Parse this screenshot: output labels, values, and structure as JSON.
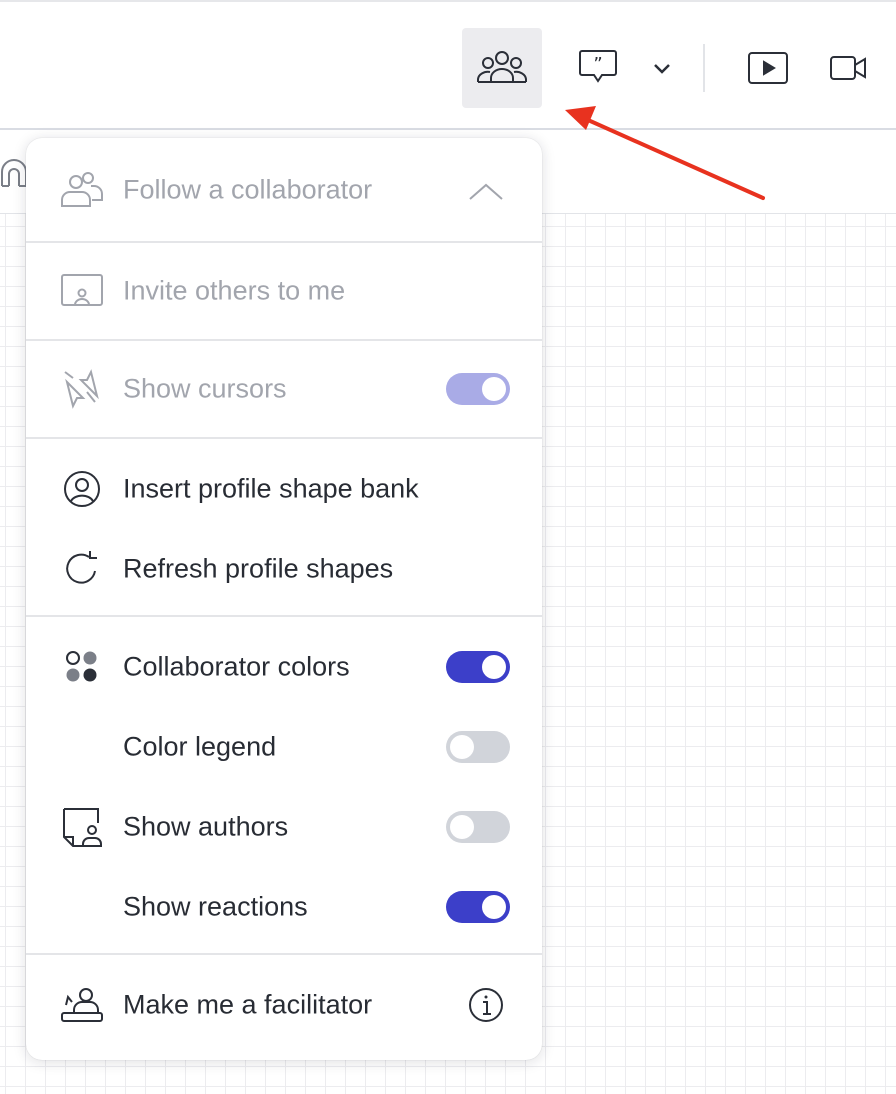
{
  "menu": {
    "follow_collaborator": {
      "label": "Follow a collaborator"
    },
    "invite_others": {
      "label": "Invite others to me"
    },
    "show_cursors": {
      "label": "Show cursors",
      "enabled": true
    },
    "insert_profile_shape_bank": {
      "label": "Insert profile shape bank"
    },
    "refresh_profile_shapes": {
      "label": "Refresh profile shapes"
    },
    "collaborator_colors": {
      "label": "Collaborator colors",
      "enabled": true
    },
    "color_legend": {
      "label": "Color legend",
      "enabled": false
    },
    "show_authors": {
      "label": "Show authors",
      "enabled": false
    },
    "show_reactions": {
      "label": "Show reactions",
      "enabled": true
    },
    "make_facilitator": {
      "label": "Make me a facilitator"
    }
  },
  "icons": {
    "toolbar": [
      "collaborators-icon",
      "comment-icon",
      "chevron-down-icon",
      "present-icon",
      "video-icon"
    ],
    "menu": [
      "follow-icon",
      "invite-icon",
      "cursors-icon",
      "profile-icon",
      "refresh-icon",
      "colors-icon",
      "authors-icon",
      "facilitator-icon",
      "info-icon"
    ]
  },
  "colors": {
    "accent": "#3c3fc9",
    "accent_dimmed": "#a9abe6",
    "toggle_off": "#d1d4da",
    "annotation_arrow": "#e8321f"
  }
}
